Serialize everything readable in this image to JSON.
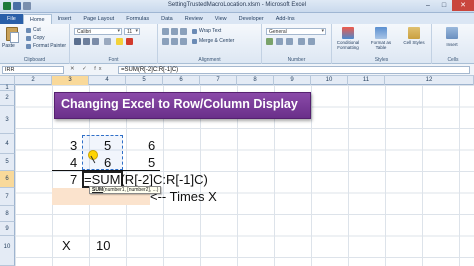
{
  "window": {
    "title": "SettingTrustedMacroLocation.xlsm - Microsoft Excel"
  },
  "tabs": [
    "File",
    "Home",
    "Insert",
    "Page Layout",
    "Formulas",
    "Data",
    "Review",
    "View",
    "Developer",
    "Add-Ins"
  ],
  "ribbon": {
    "clipboard": {
      "paste": "Paste",
      "cut": "Cut",
      "copy": "Copy",
      "format_painter": "Format Painter",
      "label": "Clipboard"
    },
    "font": {
      "name": "Calibri",
      "size": "11",
      "label": "Font"
    },
    "alignment": {
      "wrap": "Wrap Text",
      "merge": "Merge & Center",
      "label": "Alignment"
    },
    "number": {
      "format": "General",
      "label": "Number"
    },
    "styles": {
      "conditional": "Conditional Formatting",
      "table": "Format as Table",
      "cell": "Cell Styles",
      "label": "Styles"
    },
    "cells": {
      "insert": "Insert",
      "label": "Cells"
    }
  },
  "formula_bar": {
    "name_box": "IRR",
    "fx": "✕ ✓ fx",
    "formula": "=SUM(R[-2]C:R[-1]C)"
  },
  "grid": {
    "columns": [
      "2",
      "3",
      "4",
      "5",
      "6",
      "7",
      "8",
      "9",
      "10",
      "11",
      "12"
    ],
    "rows": [
      "1",
      "2",
      "3",
      "4",
      "5",
      "6",
      "7",
      "8",
      "9",
      "10"
    ],
    "banner": "Changing Excel to Row/Column Display",
    "values": {
      "r4c2": "3",
      "r4c3": "5",
      "r4c4": "6",
      "r5c2": "4",
      "r5c3": "6",
      "r5c4": "5",
      "r6c2": "7",
      "r6c3": "=SUM(R[-2]C:R[-1]C)",
      "r7note": "<-- Times X",
      "r10c2": "X",
      "r10c3": "10"
    },
    "tooltip": {
      "fn": "SUM",
      "args": "(number1, [number2], ...)"
    }
  }
}
